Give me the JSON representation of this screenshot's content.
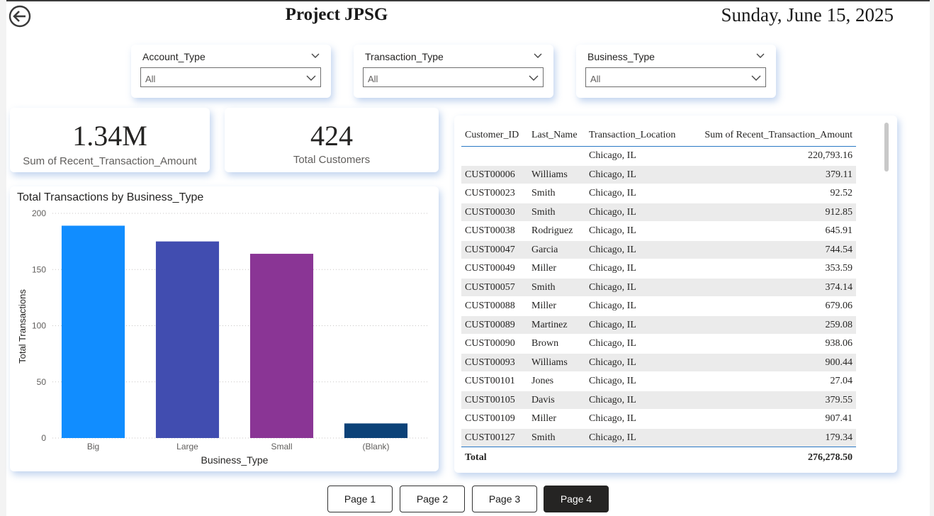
{
  "header": {
    "title": "Project JPSG",
    "date": "Sunday, June 15, 2025"
  },
  "slicers": [
    {
      "label": "Account_Type",
      "value": "All"
    },
    {
      "label": "Transaction_Type",
      "value": "All"
    },
    {
      "label": "Business_Type",
      "value": "All"
    }
  ],
  "kpis": [
    {
      "value": "1.34M",
      "label": "Sum of Recent_Transaction_Amount"
    },
    {
      "value": "424",
      "label": "Total Customers"
    }
  ],
  "chart_data": {
    "type": "bar",
    "title": "Total Transactions by Business_Type",
    "xlabel": "Business_Type",
    "ylabel": "Total Transactions",
    "categories": [
      "Big",
      "Large",
      "Small",
      "(Blank)"
    ],
    "values": [
      189,
      175,
      164,
      13
    ],
    "colors": [
      "#118dff",
      "#414db0",
      "#8a3595",
      "#0c4278"
    ],
    "ylim": [
      0,
      200
    ],
    "yticks": [
      0,
      50,
      100,
      150,
      200
    ],
    "grid": true
  },
  "table": {
    "columns": [
      "Customer_ID",
      "Last_Name",
      "Transaction_Location",
      "Sum of Recent_Transaction_Amount"
    ],
    "rows": [
      [
        "",
        "",
        "Chicago, IL",
        "220,793.16"
      ],
      [
        "CUST00006",
        "Williams",
        "Chicago, IL",
        "379.11"
      ],
      [
        "CUST00023",
        "Smith",
        "Chicago, IL",
        "92.52"
      ],
      [
        "CUST00030",
        "Smith",
        "Chicago, IL",
        "912.85"
      ],
      [
        "CUST00038",
        "Rodriguez",
        "Chicago, IL",
        "645.91"
      ],
      [
        "CUST00047",
        "Garcia",
        "Chicago, IL",
        "744.54"
      ],
      [
        "CUST00049",
        "Miller",
        "Chicago, IL",
        "353.59"
      ],
      [
        "CUST00057",
        "Smith",
        "Chicago, IL",
        "374.14"
      ],
      [
        "CUST00088",
        "Miller",
        "Chicago, IL",
        "679.06"
      ],
      [
        "CUST00089",
        "Martinez",
        "Chicago, IL",
        "259.08"
      ],
      [
        "CUST00090",
        "Brown",
        "Chicago, IL",
        "938.06"
      ],
      [
        "CUST00093",
        "Williams",
        "Chicago, IL",
        "900.44"
      ],
      [
        "CUST00101",
        "Jones",
        "Chicago, IL",
        "27.04"
      ],
      [
        "CUST00105",
        "Davis",
        "Chicago, IL",
        "379.55"
      ],
      [
        "CUST00109",
        "Miller",
        "Chicago, IL",
        "907.41"
      ],
      [
        "CUST00127",
        "Smith",
        "Chicago, IL",
        "179.34"
      ]
    ],
    "total_label": "Total",
    "total_value": "276,278.50"
  },
  "pages": [
    {
      "label": "Page 1",
      "active": false
    },
    {
      "label": "Page 2",
      "active": false
    },
    {
      "label": "Page 3",
      "active": false
    },
    {
      "label": "Page 4",
      "active": true
    }
  ],
  "icons": {
    "back": "back-arrow-circle-icon",
    "chevron": "chevron-down-icon"
  }
}
